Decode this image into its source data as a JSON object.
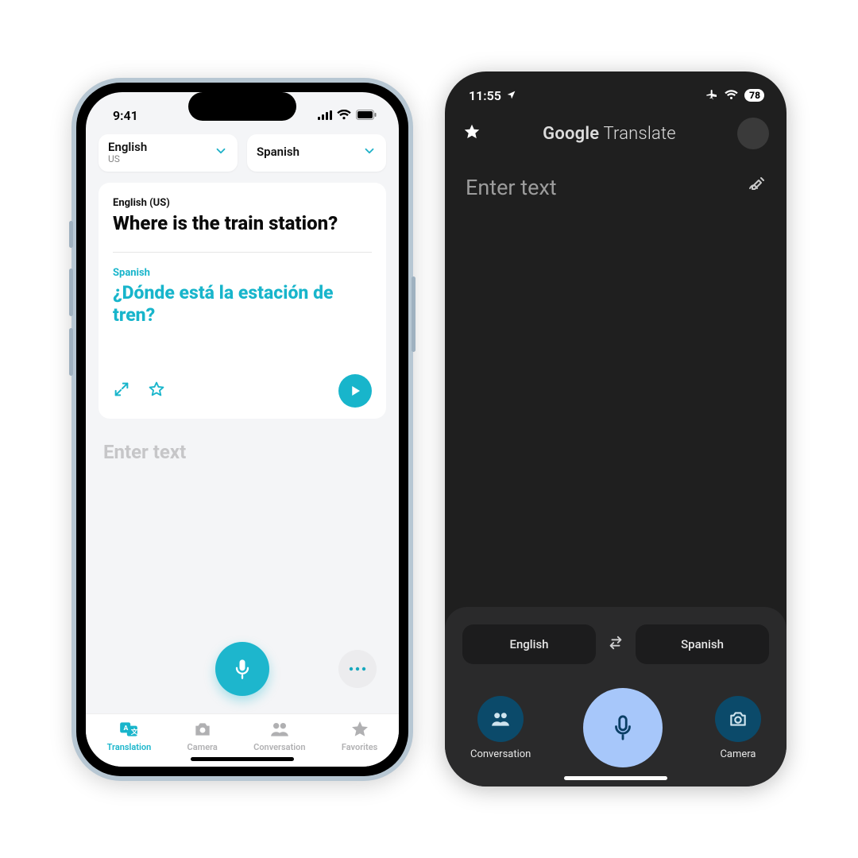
{
  "left": {
    "statusbar": {
      "time": "9:41"
    },
    "lang": {
      "source": {
        "main": "English",
        "sub": "US"
      },
      "target": {
        "main": "Spanish"
      }
    },
    "card": {
      "src_label": "English (US)",
      "src_text": "Where is the train station?",
      "tgt_label": "Spanish",
      "tgt_text": "¿Dónde está la estación de tren?"
    },
    "enter_placeholder": "Enter text",
    "tabs": {
      "translation": "Translation",
      "camera": "Camera",
      "conversation": "Conversation",
      "favorites": "Favorites"
    },
    "colors": {
      "accent": "#18b5cb"
    }
  },
  "right": {
    "statusbar": {
      "time": "11:55",
      "battery": "78"
    },
    "header": {
      "title_bold": "Google",
      "title_thin": " Translate"
    },
    "enter_placeholder": "Enter text",
    "lang": {
      "source": "English",
      "target": "Spanish"
    },
    "actions": {
      "conversation": "Conversation",
      "camera": "Camera"
    },
    "colors": {
      "mic_bg": "#a7c7fa",
      "side_circle": "#0b4a6a"
    }
  }
}
